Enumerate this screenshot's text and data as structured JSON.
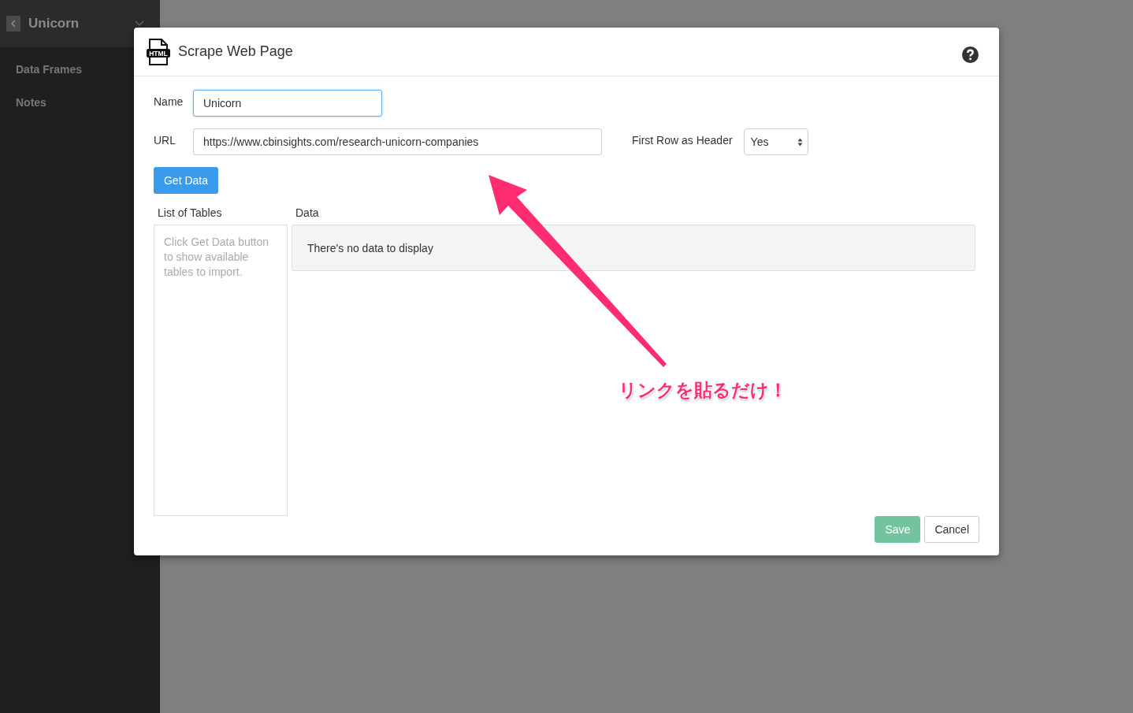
{
  "sidebar": {
    "title": "Unicorn",
    "items": [
      {
        "label": "Data Frames"
      },
      {
        "label": "Notes"
      }
    ]
  },
  "dialog": {
    "file_icon_text": "HTML",
    "title": "Scrape Web Page",
    "name_field": {
      "label": "Name",
      "value": "Unicorn",
      "focused": true
    },
    "url_field": {
      "label": "URL",
      "value": "https://www.cbinsights.com/research-unicorn-companies",
      "focused": false
    },
    "header_select": {
      "label": "First Row as Header",
      "value": "Yes"
    },
    "get_data_button": "Get Data",
    "list_of_tables": {
      "title": "List of Tables",
      "hint": "Click Get Data button to show available tables to import."
    },
    "data": {
      "title": "Data",
      "empty_text": "There's no data to display"
    },
    "buttons": [
      {
        "label": "Save",
        "kind": "primary",
        "disabled": true
      },
      {
        "label": "Cancel",
        "kind": "default",
        "disabled": false
      }
    ]
  },
  "annotation": {
    "text": "リンクを貼るだけ！"
  }
}
